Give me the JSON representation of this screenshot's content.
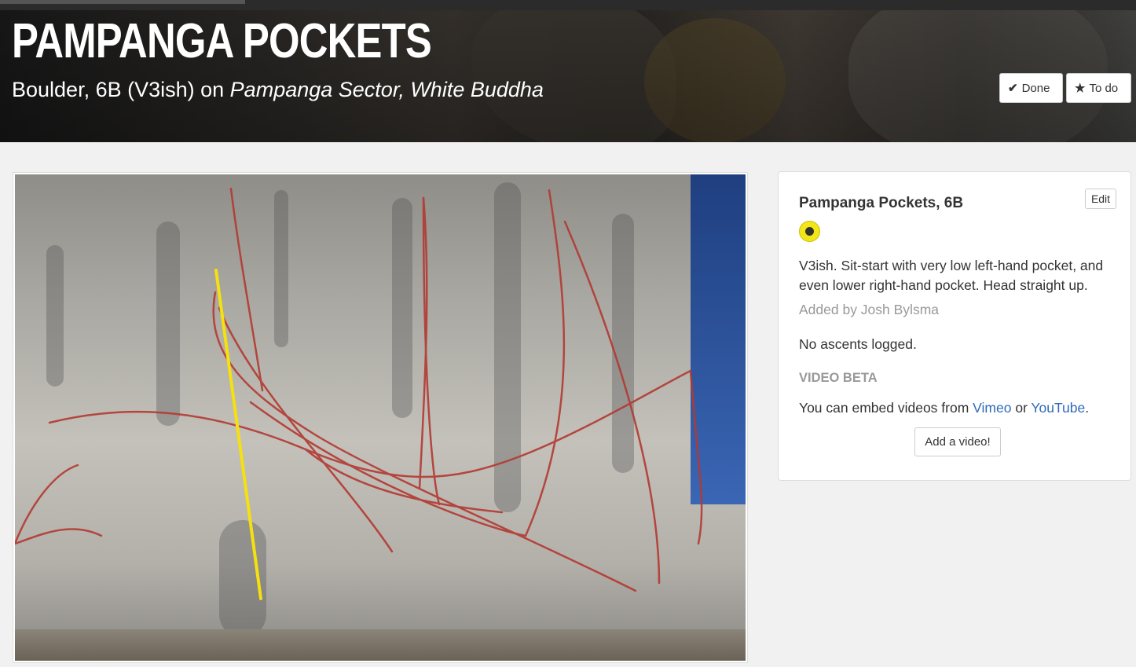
{
  "header": {
    "title": "PAMPANGA POCKETS",
    "subtitle_prefix": "Boulder, 6B (V3ish) on ",
    "subtitle_location": "Pampanga Sector, White Buddha",
    "done_label": "Done",
    "todo_label": "To do"
  },
  "info": {
    "name": "Pampanga Pockets, 6B",
    "edit_label": "Edit",
    "grade_color": "#f2e617",
    "description": "V3ish. Sit-start with very low left-hand pocket, and even lower right-hand pocket. Head straight up.",
    "added_by": "Added by Josh Bylsma",
    "ascents": "No ascents logged.",
    "video_heading": "VIDEO BETA",
    "embed_prefix": "You can embed videos from ",
    "vimeo": "Vimeo",
    "embed_or": " or ",
    "youtube": "YouTube",
    "embed_suffix": ".",
    "add_video_label": "Add a video!"
  },
  "colors": {
    "highlight_line": "#f5e010",
    "other_lines": "#b23a32",
    "link": "#2d6bb8"
  },
  "icons": {
    "done": "check-icon",
    "todo": "star-icon",
    "grade": "grade-dot-icon"
  }
}
